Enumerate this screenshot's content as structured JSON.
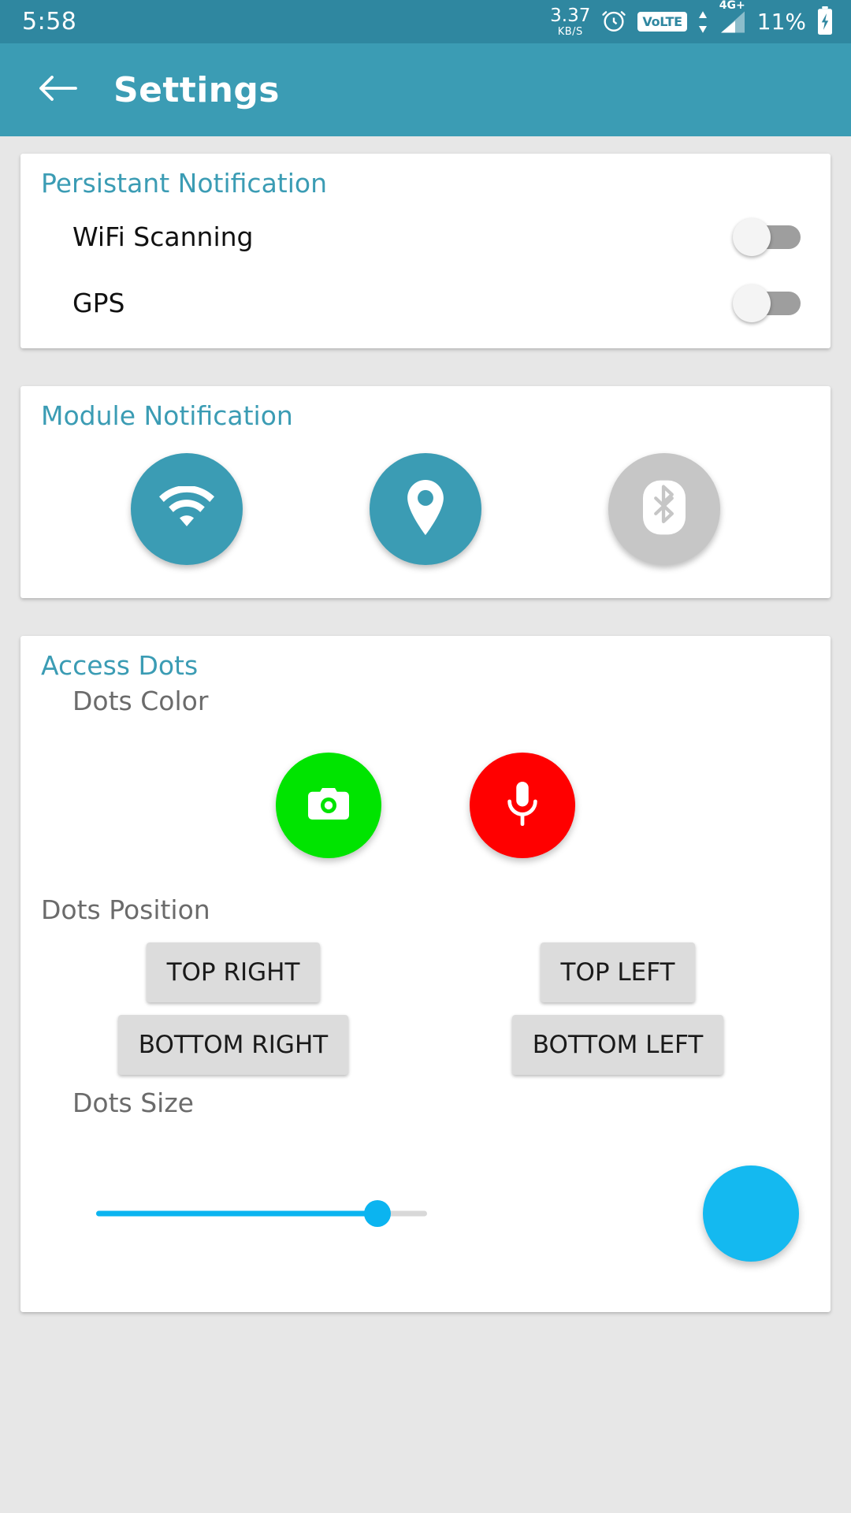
{
  "status_bar": {
    "clock": "5:58",
    "net_speed_value": "3.37",
    "net_speed_unit": "KB/S",
    "alarm_icon": "alarm-clock-icon",
    "volte_label": "VoLTE",
    "network_type": "4G",
    "network_plus": "+",
    "battery_percent": "11%",
    "battery_icon": "charging-battery-icon",
    "background_color": "#2f87a0"
  },
  "toolbar": {
    "back_icon": "back-arrow-icon",
    "title": "Settings",
    "background_color": "#3b9cb4"
  },
  "theme": {
    "accent": "#3b9cb4",
    "page_background": "#e7e7e7",
    "card_background": "#ffffff"
  },
  "cards": {
    "persistant_notification": {
      "title": "Persistant Notification",
      "rows": [
        {
          "label": "WiFi Scanning",
          "switch_state": "off"
        },
        {
          "label": "GPS",
          "switch_state": "off"
        }
      ]
    },
    "module_notification": {
      "title": "Module Notification",
      "modules": [
        {
          "icon": "wifi-icon",
          "state": "enabled",
          "color": "#3b9cb4"
        },
        {
          "icon": "location-pin-icon",
          "state": "enabled",
          "color": "#3b9cb4"
        },
        {
          "icon": "bluetooth-icon",
          "state": "disabled",
          "color": "#c6c6c6"
        }
      ]
    },
    "access_dots": {
      "title": "Access Dots",
      "dots_color_label": "Dots Color",
      "color_dots": [
        {
          "icon": "camera-icon",
          "color": "#00e400"
        },
        {
          "icon": "microphone-icon",
          "color": "#ff0000"
        }
      ],
      "dots_position_label": "Dots Position",
      "position_buttons": [
        "TOP RIGHT",
        "TOP LEFT",
        "BOTTOM RIGHT",
        "BOTTOM LEFT"
      ],
      "dots_size_label": "Dots Size",
      "size_slider": {
        "percent": 85,
        "fill_color": "#0bb4f0",
        "track_color": "#d8d8d8"
      },
      "size_preview_color": "#14b9f0"
    }
  }
}
